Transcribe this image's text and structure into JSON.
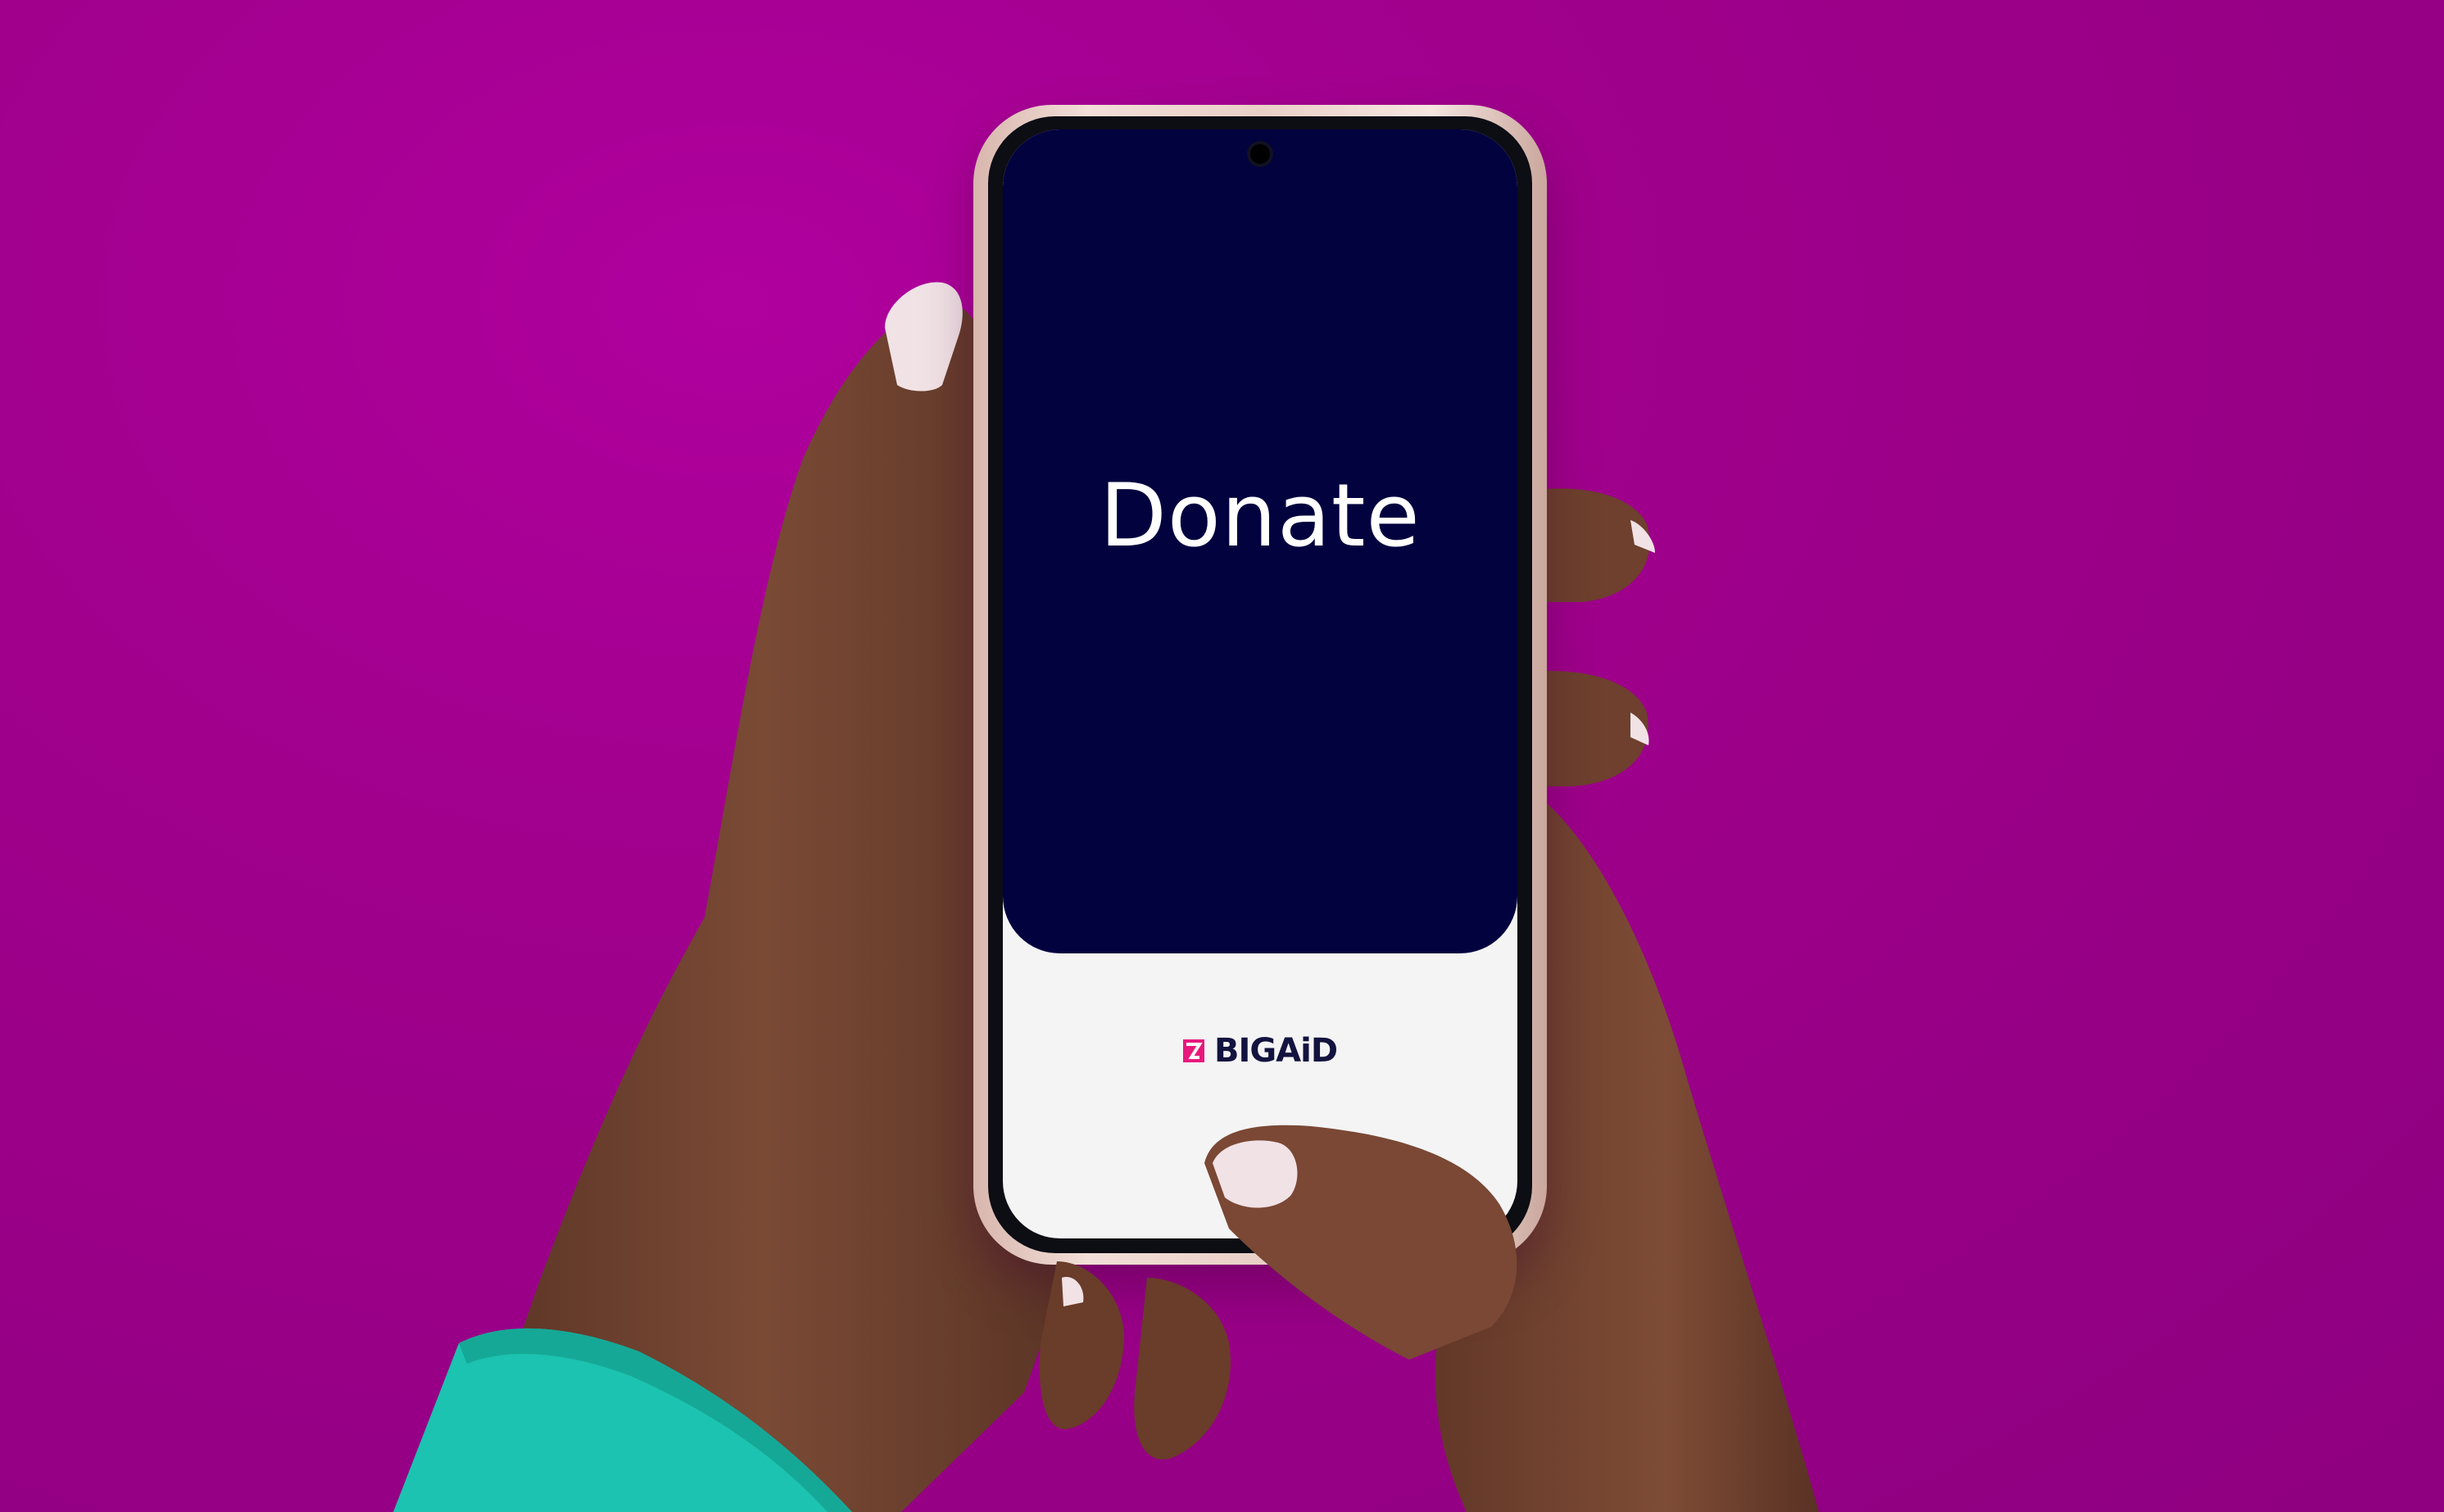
{
  "scene": {
    "background_color": "#a0008c",
    "phone_screen_color": "#02023f",
    "sleeve_color": "#1cc3b0"
  },
  "app": {
    "title": "Donate",
    "brand": "BIGAiD",
    "brand_color": "#13133f",
    "brand_mark_color": "#e8187d"
  }
}
